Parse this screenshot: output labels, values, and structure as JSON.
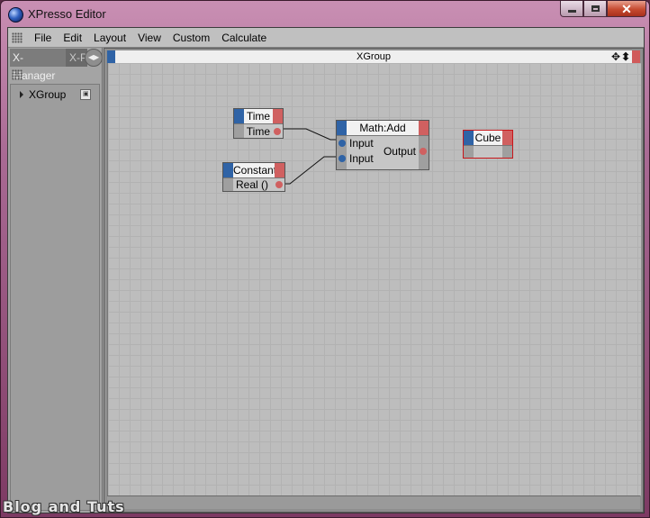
{
  "window": {
    "title": "XPresso Editor",
    "icon": "cinema4d-app-icon"
  },
  "menubar": {
    "items": [
      "File",
      "Edit",
      "Layout",
      "View",
      "Custom",
      "Calculate"
    ]
  },
  "left_panel": {
    "tabs": [
      {
        "label": "X-Manager",
        "active": true
      },
      {
        "label": "X-P",
        "active": false
      }
    ],
    "tree": {
      "root_label": "XGroup",
      "expanded": false
    }
  },
  "editor": {
    "group_title": "XGroup",
    "nodes": {
      "time": {
        "title": "Time",
        "outputs": [
          "Time"
        ]
      },
      "constant": {
        "title": "Constant",
        "outputs": [
          "Real ()"
        ]
      },
      "math_add": {
        "title": "Math:Add",
        "inputs": [
          "Input",
          "Input"
        ],
        "outputs": [
          "Output"
        ]
      },
      "cube": {
        "title": "Cube",
        "selected": true
      }
    }
  },
  "colors": {
    "node_input_blue": "#2f63a6",
    "node_output_red": "#d06060",
    "selection_red": "#c8161a"
  },
  "watermark": "Blog and Tuts"
}
